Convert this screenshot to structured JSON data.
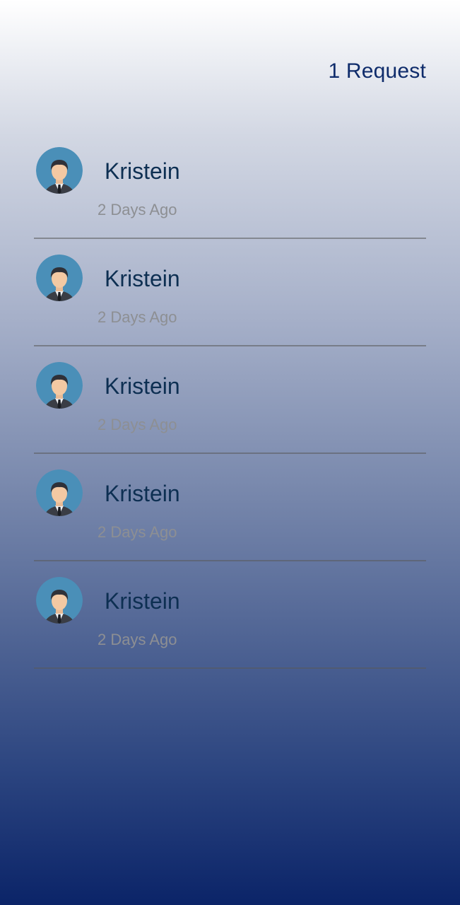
{
  "header": {
    "request_count": "1 Request"
  },
  "requests": [
    {
      "name": "Kristein",
      "time": "2 Days Ago",
      "avatar_icon": "businessman-avatar-icon"
    },
    {
      "name": "Kristein",
      "time": "2 Days Ago",
      "avatar_icon": "businessman-avatar-icon"
    },
    {
      "name": "Kristein",
      "time": "2 Days Ago",
      "avatar_icon": "businessman-avatar-icon"
    },
    {
      "name": "Kristein",
      "time": "2 Days Ago",
      "avatar_icon": "businessman-avatar-icon"
    },
    {
      "name": "Kristein",
      "time": "2 Days Ago",
      "avatar_icon": "businessman-avatar-icon"
    }
  ],
  "colors": {
    "gradient_top": "#ffffff",
    "gradient_bottom": "#0b2468",
    "name_text": "#0d2f52",
    "time_text": "#8d8f93",
    "header_text": "#0f2c6b",
    "avatar_bg": "#4a8fb8"
  }
}
